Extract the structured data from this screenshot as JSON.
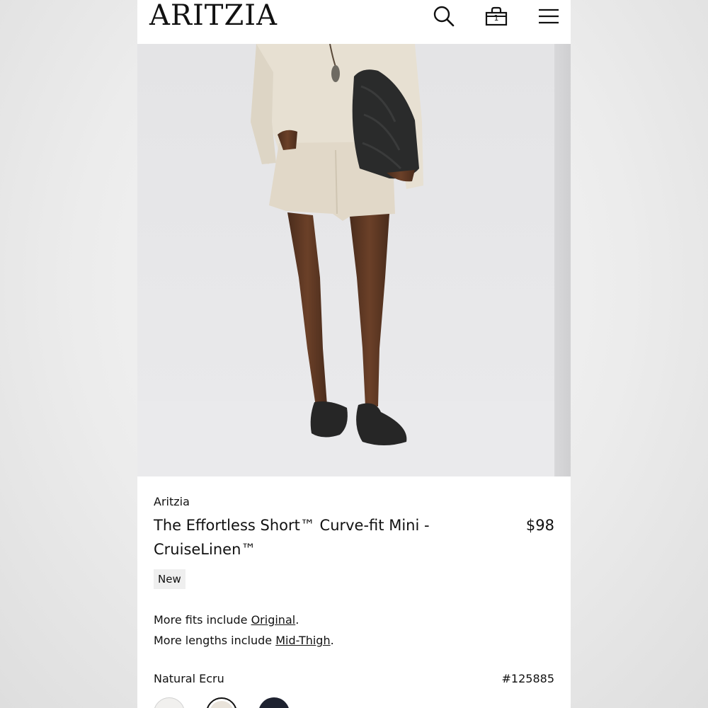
{
  "header": {
    "logo": "ARITZIA",
    "bag_count": "1",
    "icons": [
      "search-icon",
      "bag-icon",
      "menu-icon"
    ]
  },
  "product": {
    "brand": "Aritzia",
    "title": "The Effortless Short™ Curve-fit Mini - CruiseLinen™",
    "price": "$98",
    "badge": "New",
    "fits_prefix": "More fits include ",
    "fits_link": "Original",
    "fits_suffix": ".",
    "lengths_prefix": "More lengths include ",
    "lengths_link": "Mid-Thigh",
    "lengths_suffix": ".",
    "color_name": "Natural Ecru",
    "style_number": "#125885",
    "swatches": [
      {
        "color": "#f1f0ee"
      },
      {
        "color": "#e9e3da",
        "selected": true
      },
      {
        "color": "#1e2230"
      }
    ]
  }
}
